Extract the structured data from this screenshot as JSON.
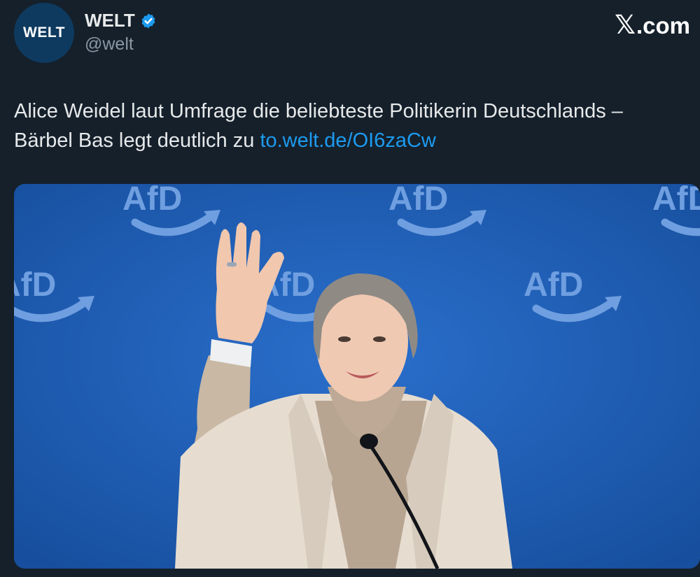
{
  "account": {
    "avatar_text": "WELT",
    "display_name": "WELT",
    "handle": "@welt",
    "verified": true
  },
  "brand": {
    "x_glyph": "𝕏",
    "suffix": ".com"
  },
  "tweet": {
    "line1": "Alice Weidel laut Umfrage die beliebteste Politikerin Deutschlands –",
    "line2_prefix": "Bärbel Bas legt deutlich zu ",
    "link": "to.welt.de/OI6zaCw"
  },
  "media": {
    "backdrop_logo_text": "AfD",
    "subject": "Woman in a beige blazer and turtleneck waving at a microphone in front of a blue AfD backdrop",
    "colors": {
      "backdrop": "#1f5fb8",
      "logo": "#6f9fe0",
      "blazer": "#e6ddd0",
      "turtleneck": "#b7a592"
    }
  },
  "colors": {
    "background": "#15202b",
    "text": "#e7e9ea",
    "secondary_text": "#8b98a5",
    "link": "#1d9bf0",
    "verified": "#1d9bf0"
  }
}
